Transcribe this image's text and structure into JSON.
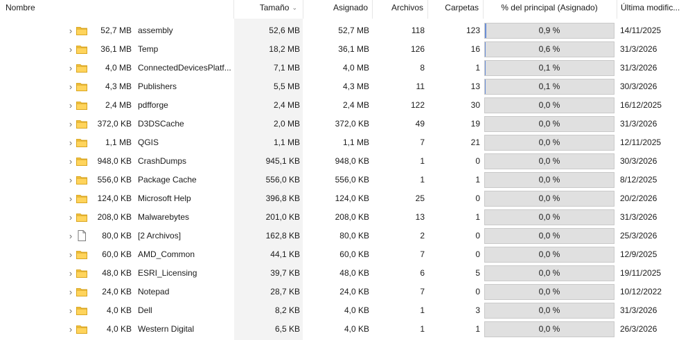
{
  "columns": {
    "name": "Nombre",
    "size": "Tamaño",
    "allocated": "Asignado",
    "files": "Archivos",
    "folders": "Carpetas",
    "percent": "% del principal (Asignado)",
    "modified": "Última modific..."
  },
  "sort_indicator": "chevron-down-icon",
  "colors": {
    "shade": "#f3f3f3",
    "bar_bg": "#e0e0e0",
    "folder": "#f4c542"
  },
  "rows": [
    {
      "icon": "folder-icon",
      "alloc_display": "52,7 MB",
      "name": "assembly",
      "size": "52,6 MB",
      "allocated": "52,7 MB",
      "files": "118",
      "folders": "123",
      "percent": "0,9 %",
      "percent_value": 0.9,
      "modified": "14/11/2025"
    },
    {
      "icon": "folder-icon",
      "alloc_display": "36,1 MB",
      "name": "Temp",
      "size": "18,2 MB",
      "allocated": "36,1 MB",
      "files": "126",
      "folders": "16",
      "percent": "0,6 %",
      "percent_value": 0.6,
      "modified": "31/3/2026"
    },
    {
      "icon": "folder-icon",
      "alloc_display": "4,0 MB",
      "name": "ConnectedDevicesPlatf...",
      "size": "7,1 MB",
      "allocated": "4,0 MB",
      "files": "8",
      "folders": "1",
      "percent": "0,1 %",
      "percent_value": 0.1,
      "modified": "31/3/2026"
    },
    {
      "icon": "folder-icon",
      "alloc_display": "4,3 MB",
      "name": "Publishers",
      "size": "5,5 MB",
      "allocated": "4,3 MB",
      "files": "11",
      "folders": "13",
      "percent": "0,1 %",
      "percent_value": 0.1,
      "modified": "30/3/2026"
    },
    {
      "icon": "folder-icon",
      "alloc_display": "2,4 MB",
      "name": "pdfforge",
      "size": "2,4 MB",
      "allocated": "2,4 MB",
      "files": "122",
      "folders": "30",
      "percent": "0,0 %",
      "percent_value": 0.0,
      "modified": "16/12/2025"
    },
    {
      "icon": "folder-icon",
      "alloc_display": "372,0 KB",
      "name": "D3DSCache",
      "size": "2,0 MB",
      "allocated": "372,0 KB",
      "files": "49",
      "folders": "19",
      "percent": "0,0 %",
      "percent_value": 0.0,
      "modified": "31/3/2026"
    },
    {
      "icon": "folder-icon",
      "alloc_display": "1,1 MB",
      "name": "QGIS",
      "size": "1,1 MB",
      "allocated": "1,1 MB",
      "files": "7",
      "folders": "21",
      "percent": "0,0 %",
      "percent_value": 0.0,
      "modified": "12/11/2025"
    },
    {
      "icon": "folder-icon",
      "alloc_display": "948,0 KB",
      "name": "CrashDumps",
      "size": "945,1 KB",
      "allocated": "948,0 KB",
      "files": "1",
      "folders": "0",
      "percent": "0,0 %",
      "percent_value": 0.0,
      "modified": "30/3/2026"
    },
    {
      "icon": "folder-icon",
      "alloc_display": "556,0 KB",
      "name": "Package Cache",
      "size": "556,0 KB",
      "allocated": "556,0 KB",
      "files": "1",
      "folders": "1",
      "percent": "0,0 %",
      "percent_value": 0.0,
      "modified": "8/12/2025"
    },
    {
      "icon": "folder-icon",
      "alloc_display": "124,0 KB",
      "name": "Microsoft Help",
      "size": "396,8 KB",
      "allocated": "124,0 KB",
      "files": "25",
      "folders": "0",
      "percent": "0,0 %",
      "percent_value": 0.0,
      "modified": "20/2/2026"
    },
    {
      "icon": "folder-icon",
      "alloc_display": "208,0 KB",
      "name": "Malwarebytes",
      "size": "201,0 KB",
      "allocated": "208,0 KB",
      "files": "13",
      "folders": "1",
      "percent": "0,0 %",
      "percent_value": 0.0,
      "modified": "31/3/2026"
    },
    {
      "icon": "file-icon",
      "alloc_display": "80,0 KB",
      "name": "[2 Archivos]",
      "size": "162,8 KB",
      "allocated": "80,0 KB",
      "files": "2",
      "folders": "0",
      "percent": "0,0 %",
      "percent_value": 0.0,
      "modified": "25/3/2026"
    },
    {
      "icon": "folder-icon",
      "alloc_display": "60,0 KB",
      "name": "AMD_Common",
      "size": "44,1 KB",
      "allocated": "60,0 KB",
      "files": "7",
      "folders": "0",
      "percent": "0,0 %",
      "percent_value": 0.0,
      "modified": "12/9/2025"
    },
    {
      "icon": "folder-icon",
      "alloc_display": "48,0 KB",
      "name": "ESRI_Licensing",
      "size": "39,7 KB",
      "allocated": "48,0 KB",
      "files": "6",
      "folders": "5",
      "percent": "0,0 %",
      "percent_value": 0.0,
      "modified": "19/11/2025"
    },
    {
      "icon": "folder-icon",
      "alloc_display": "24,0 KB",
      "name": "Notepad",
      "size": "28,7 KB",
      "allocated": "24,0 KB",
      "files": "7",
      "folders": "0",
      "percent": "0,0 %",
      "percent_value": 0.0,
      "modified": "10/12/2022"
    },
    {
      "icon": "folder-icon",
      "alloc_display": "4,0 KB",
      "name": "Dell",
      "size": "8,2 KB",
      "allocated": "4,0 KB",
      "files": "1",
      "folders": "3",
      "percent": "0,0 %",
      "percent_value": 0.0,
      "modified": "31/3/2026"
    },
    {
      "icon": "folder-icon",
      "alloc_display": "4,0 KB",
      "name": "Western Digital",
      "size": "6,5 KB",
      "allocated": "4,0 KB",
      "files": "1",
      "folders": "1",
      "percent": "0,0 %",
      "percent_value": 0.0,
      "modified": "26/3/2026"
    }
  ]
}
